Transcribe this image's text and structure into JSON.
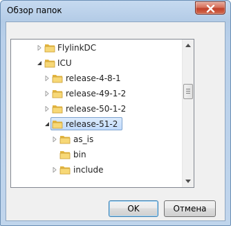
{
  "window": {
    "title": "Обзор папок"
  },
  "tree": {
    "items": [
      {
        "label": "FlylinkDC",
        "expander": "collapsed"
      },
      {
        "label": "ICU",
        "expander": "expanded"
      },
      {
        "label": "release-4-8-1",
        "expander": "collapsed"
      },
      {
        "label": "release-49-1-2",
        "expander": "collapsed"
      },
      {
        "label": "release-50-1-2",
        "expander": "collapsed"
      },
      {
        "label": "release-51-2",
        "expander": "expanded",
        "selected": true
      },
      {
        "label": "as_is",
        "expander": "collapsed"
      },
      {
        "label": "bin",
        "expander": "none"
      },
      {
        "label": "include",
        "expander": "collapsed"
      }
    ]
  },
  "buttons": {
    "ok_label": "OK",
    "cancel_label": "Отмена"
  },
  "colors": {
    "folder": "#e8c45a",
    "selection": "#c1dbfc",
    "title_bg": "#b9d0ea",
    "close": "#c1412a"
  }
}
